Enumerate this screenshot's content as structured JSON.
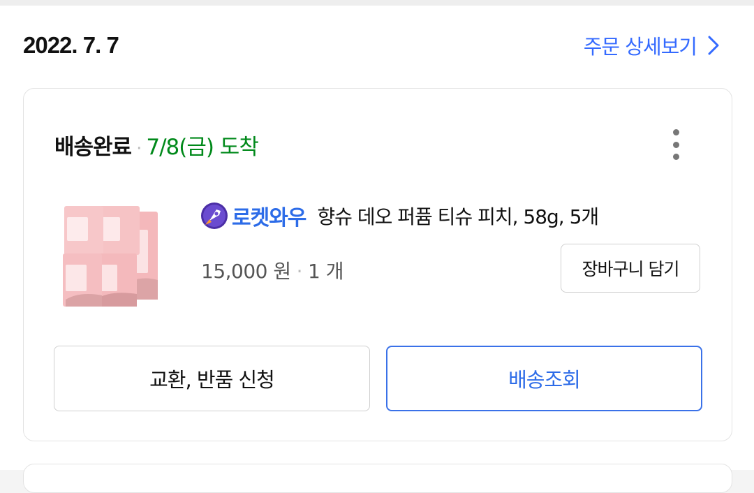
{
  "order": {
    "date": "2022. 7. 7",
    "detail_link_label": "주문 상세보기"
  },
  "shipment": {
    "status_label": "배송완료",
    "separator": "·",
    "arrival_text": "7/8(금) 도착"
  },
  "item": {
    "badge_label": "로켓와우",
    "product_name": "향슈 데오 퍼퓸 티슈 피치, 58g, 5개",
    "price": "15,000 원",
    "separator": "·",
    "quantity": "1 개",
    "cart_button_label": "장바구니 담기"
  },
  "actions": {
    "exchange_return_label": "교환, 반품 신청",
    "track_delivery_label": "배송조회"
  },
  "colors": {
    "accent_blue": "#346aff",
    "arrival_green": "#00891a"
  },
  "icons": [
    "chevron-right-icon",
    "more-vertical-icon",
    "rocket-icon"
  ]
}
